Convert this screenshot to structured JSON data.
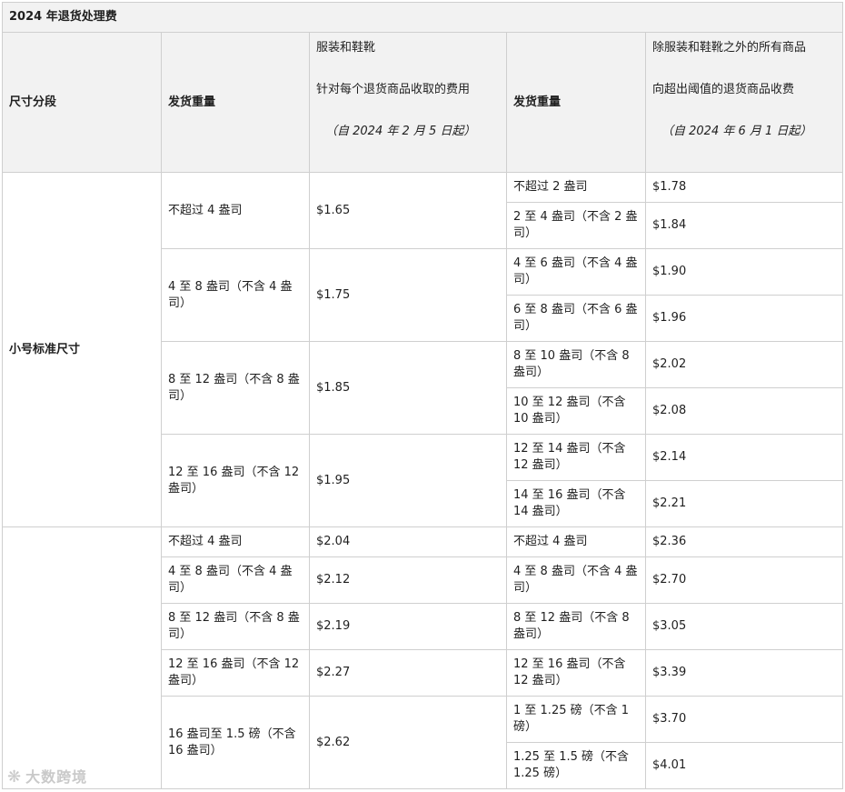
{
  "title": "2024 年退货处理费",
  "headers": {
    "size_tier": "尺寸分段",
    "ship_weight_1": "发货重量",
    "apparel_line1": "服装和鞋靴",
    "apparel_line2": "针对每个退货商品收取的费用",
    "apparel_note": "（自 2024 年 2 月 5 日起）",
    "ship_weight_2": "发货重量",
    "nonapparel_line1": "除服装和鞋靴之外的所有商品",
    "nonapparel_line2": "向超出阈值的退货商品收费",
    "nonapparel_note": "（自 2024 年 6 月 1 日起）"
  },
  "tiers": {
    "small": "小号标准尺寸",
    "large": ""
  },
  "small_rows": [
    {
      "w1": "不超过 4 盎司",
      "f1": "$1.65",
      "subs": [
        {
          "w2": "不超过 2 盎司",
          "f2": "$1.78"
        },
        {
          "w2": "2 至 4 盎司（不含 2 盎司）",
          "f2": "$1.84"
        }
      ]
    },
    {
      "w1": "4 至 8 盎司（不含 4 盎司）",
      "f1": "$1.75",
      "subs": [
        {
          "w2": "4 至 6 盎司（不含 4 盎司）",
          "f2": "$1.90"
        },
        {
          "w2": "6 至 8 盎司（不含 6 盎司）",
          "f2": "$1.96"
        }
      ]
    },
    {
      "w1": "8 至 12 盎司（不含 8 盎司）",
      "f1": "$1.85",
      "subs": [
        {
          "w2": "8 至 10 盎司（不含 8 盎司）",
          "f2": "$2.02"
        },
        {
          "w2": "10 至 12 盎司（不含 10 盎司）",
          "f2": "$2.08"
        }
      ]
    },
    {
      "w1": "12 至 16 盎司（不含 12 盎司）",
      "f1": "$1.95",
      "subs": [
        {
          "w2": "12 至 14 盎司（不含 12 盎司）",
          "f2": "$2.14"
        },
        {
          "w2": "14 至 16 盎司（不含 14 盎司）",
          "f2": "$2.21"
        }
      ]
    }
  ],
  "large_rows": [
    {
      "w1": "不超过 4 盎司",
      "f1": "$2.04",
      "w2": "不超过 4 盎司",
      "f2": "$2.36"
    },
    {
      "w1": "4 至 8 盎司（不含 4 盎司）",
      "f1": "$2.12",
      "w2": "4 至 8 盎司（不含 4 盎司）",
      "f2": "$2.70"
    },
    {
      "w1": "8 至 12 盎司（不含 8 盎司）",
      "f1": "$2.19",
      "w2": "8 至 12 盎司（不含 8 盎司）",
      "f2": "$3.05"
    },
    {
      "w1": "12 至 16 盎司（不含 12 盎司）",
      "f1": "$2.27",
      "w2": "12 至 16 盎司（不含 12 盎司）",
      "f2": "$3.39"
    }
  ],
  "large_last": {
    "w1": "16 盎司至 1.5 磅（不含 16 盎司）",
    "f1": "$2.62",
    "subs": [
      {
        "w2": "1 至 1.25 磅（不含 1 磅）",
        "f2": "$3.70"
      },
      {
        "w2": "1.25 至 1.5 磅（不含 1.25 磅）",
        "f2": "$4.01"
      }
    ]
  },
  "watermark": "大数跨境"
}
